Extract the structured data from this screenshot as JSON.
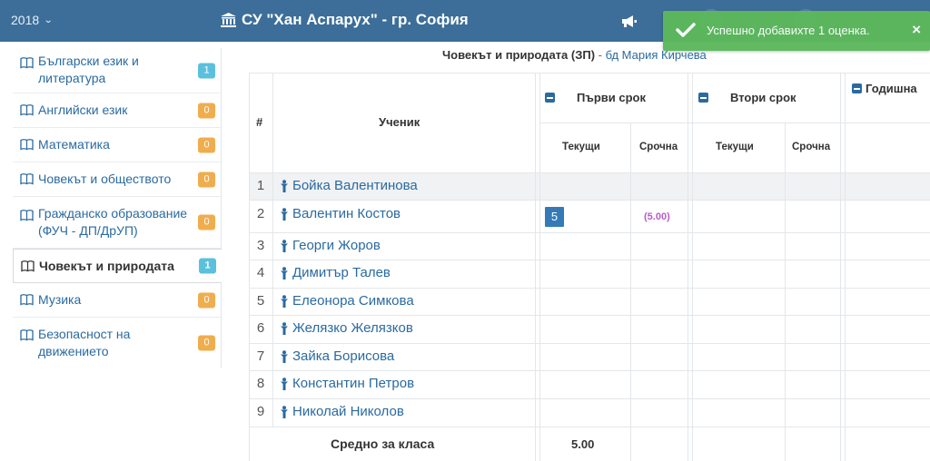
{
  "topbar": {
    "year": "2018",
    "school": "СУ \"Хан Аспарух\" - гр. София"
  },
  "toast": {
    "message": "Успешно добавихте 1 оценка.",
    "close": "×"
  },
  "sidebar": {
    "items": [
      {
        "label": "Български език и литература",
        "badge": "1",
        "color": "teal"
      },
      {
        "label": "Английски език",
        "badge": "0",
        "color": "yellow"
      },
      {
        "label": "Математика",
        "badge": "0",
        "color": "yellow"
      },
      {
        "label": "Човекът и обществото",
        "badge": "0",
        "color": "yellow"
      },
      {
        "label": "Гражданско образование (ФУЧ - ДП/ДрУП)",
        "badge": "0",
        "color": "yellow"
      },
      {
        "label": "Човекът и природата",
        "badge": "1",
        "color": "teal",
        "active": true
      },
      {
        "label": "Музика",
        "badge": "0",
        "color": "yellow"
      },
      {
        "label": "Безопасност на движението",
        "badge": "0",
        "color": "yellow"
      }
    ]
  },
  "subject": {
    "name": "Човекът и природата (ЗП)",
    "separator": " - ",
    "teacher_prefix": "бд",
    "teacher": "Мария Кирчева"
  },
  "table": {
    "col_num": "#",
    "col_student": "Ученик",
    "term1": "Първи срок",
    "term2": "Втори срок",
    "annual": "Годишна",
    "current": "Текущи",
    "term_grade": "Срочна",
    "students": [
      "Бойка Валентинова",
      "Валентин Костов",
      "Георги Жоров",
      "Димитър Талев",
      "Елеонора Симкова",
      "Желязко Желязков",
      "Зайка Борисова",
      "Константин Петров",
      "Николай Николов"
    ],
    "row_numbers": [
      "1",
      "2",
      "3",
      "4",
      "5",
      "6",
      "7",
      "8",
      "9"
    ],
    "grade_row2_current": "5",
    "grade_row2_term": "(5.00)",
    "avg_label": "Средно за класа",
    "avg_value": "5.00"
  },
  "colors": {
    "topbar": "#3c6e99",
    "toast": "#5cb85c",
    "link": "#2a6aa0",
    "badge_teal": "#5bc0de",
    "badge_yellow": "#f0ad4e",
    "grade": "#337ab7",
    "term_grade": "#b65dc9"
  }
}
